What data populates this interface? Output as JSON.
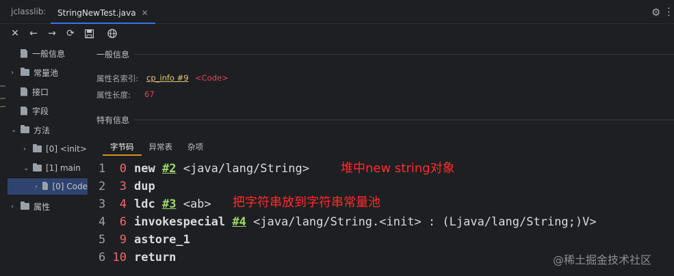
{
  "tabbar": {
    "tool_label": "jclasslib:",
    "active_tab": "StringNewTest.java",
    "close_glyph": "✕",
    "gear_icon": "gear-icon",
    "more_icon": "more-vertical-icon"
  },
  "toolbar": {
    "icons": [
      "close-icon",
      "back-arrow-icon",
      "forward-arrow-icon",
      "refresh-icon",
      "save-icon",
      "browser-icon"
    ]
  },
  "tree": {
    "items": [
      {
        "label": "一般信息"
      },
      {
        "label": "常量池"
      },
      {
        "label": "接口"
      },
      {
        "label": "字段"
      },
      {
        "label": "方法"
      },
      {
        "label": "[0] <init>"
      },
      {
        "label": "[1] main"
      },
      {
        "label": "[0] Code"
      },
      {
        "label": "属性"
      }
    ]
  },
  "general": {
    "title": "一般信息",
    "name_index_label": "属性名索引:",
    "name_index_link": "cp_info #9",
    "name_index_value": "<Code>",
    "length_label": "属性长度:",
    "length_value": "67"
  },
  "specific": {
    "title": "特有信息",
    "tabs": [
      "字节码",
      "异常表",
      "杂项"
    ]
  },
  "bytecode": [
    {
      "line": "1",
      "offset": "0",
      "op": "new",
      "ref": "#2",
      "arg": "<java/lang/String>"
    },
    {
      "line": "2",
      "offset": "3",
      "op": "dup",
      "ref": "",
      "arg": ""
    },
    {
      "line": "3",
      "offset": "4",
      "op": "ldc",
      "ref": "#3",
      "arg": "<ab>"
    },
    {
      "line": "4",
      "offset": "6",
      "op": "invokespecial",
      "ref": "#4",
      "arg": "<java/lang/String.<init> : (Ljava/lang/String;)V>"
    },
    {
      "line": "5",
      "offset": "9",
      "op": "astore_1",
      "ref": "",
      "arg": ""
    },
    {
      "line": "6",
      "offset": "10",
      "op": "return",
      "ref": "",
      "arg": ""
    }
  ],
  "annotations": {
    "note1": "堆中new string对象",
    "note2": "把字符串放到字符串常量池"
  },
  "watermark": "@稀土掘金技术社区",
  "colors": {
    "accent": "#3574f0",
    "subtab_underline": "#d4911e",
    "annotation": "#ff2b2b",
    "reference": "#9fdc6a",
    "offset": "#f06a6a"
  }
}
